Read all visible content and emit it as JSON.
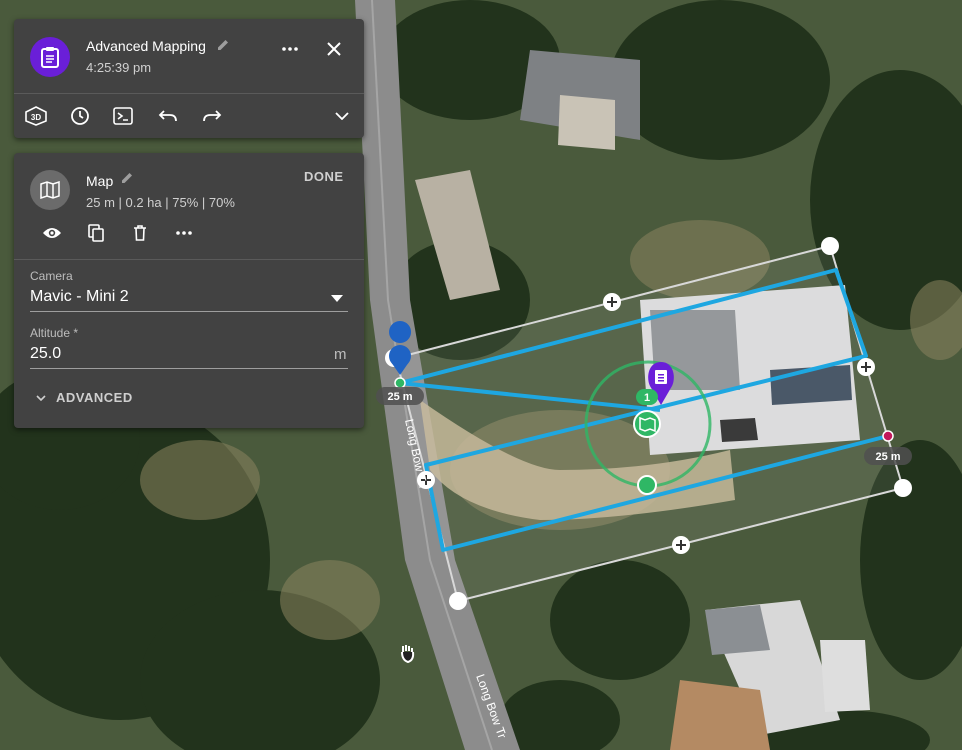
{
  "mission": {
    "title": "Advanced Mapping",
    "time": "4:25:39 pm",
    "icons": [
      "clipboard-icon",
      "pencil-icon",
      "more-icon",
      "close-icon"
    ],
    "toolbar_icons": [
      "3d-view-icon",
      "history-icon",
      "terminal-icon",
      "undo-icon",
      "redo-icon",
      "chevron-down-icon"
    ]
  },
  "layer": {
    "title": "Map",
    "stats": "25 m | 0.2 ha | 75% | 70%",
    "done_label": "DONE",
    "camera_label": "Camera",
    "camera_value": "Mavic - Mini 2",
    "altitude_label": "Altitude *",
    "altitude_value": "25.0",
    "altitude_unit": "m",
    "advanced_label": "ADVANCED"
  },
  "map_overlay": {
    "dist_left": "25 m",
    "dist_right": "25 m",
    "waypoint_number": "1",
    "road_label_1": "Long Bow Trl",
    "road_label_2": "Long Bow Tr"
  },
  "colors": {
    "flight_path": "#1ea7e1",
    "polygon_edge": "#d8d8d8",
    "purple_accent": "#6a1fd8",
    "green_accent": "#2fb765",
    "panel_bg": "#424242"
  }
}
